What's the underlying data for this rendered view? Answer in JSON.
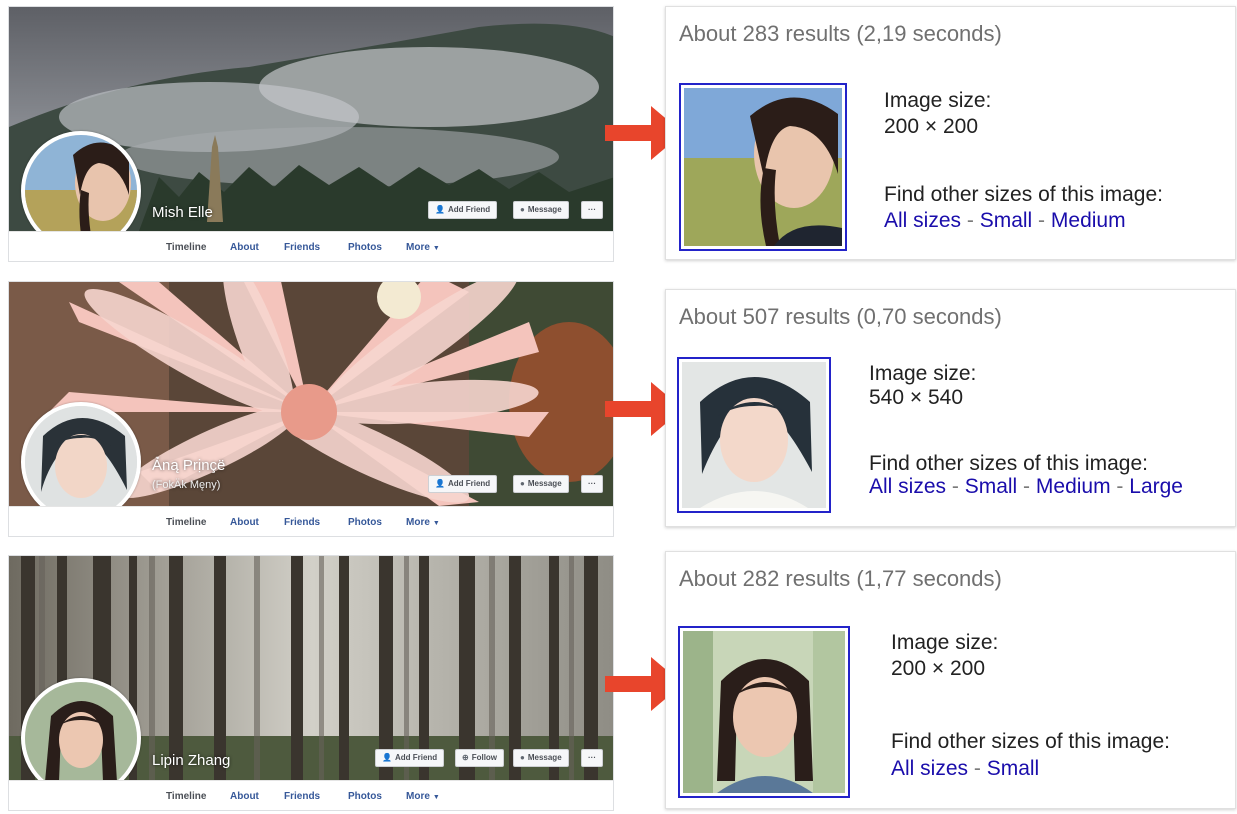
{
  "profiles": [
    {
      "name": "Mish Elle",
      "subtitle": "",
      "buttons": [
        "Add Friend",
        "Message",
        "···"
      ],
      "nav": [
        "Timeline",
        "About",
        "Friends",
        "Photos",
        "More"
      ]
    },
    {
      "name": "Ảną Prịnçë",
      "subtitle": "(FokÄk Męny)",
      "buttons": [
        "Add Friend",
        "Message",
        "···"
      ],
      "nav": [
        "Timeline",
        "About",
        "Friends",
        "Photos",
        "More"
      ]
    },
    {
      "name": "Lipin Zhang",
      "subtitle": "",
      "buttons": [
        "Add Friend",
        "Follow",
        "Message",
        "···"
      ],
      "nav": [
        "Timeline",
        "About",
        "Friends",
        "Photos",
        "More"
      ]
    }
  ],
  "results": [
    {
      "count": "About 283 results (2,19 seconds)",
      "size_label": "Image size:",
      "size_value": "200 × 200",
      "other_label": "Find other sizes of this image:",
      "links": [
        "All sizes",
        "Small",
        "Medium"
      ]
    },
    {
      "count": "About 507 results (0,70 seconds)",
      "size_label": "Image size:",
      "size_value": "540 × 540",
      "other_label": "Find other sizes of this image:",
      "links": [
        "All sizes",
        "Small",
        "Medium",
        "Large"
      ]
    },
    {
      "count": "About 282 results (1,77 seconds)",
      "size_label": "Image size:",
      "size_value": "200 × 200",
      "other_label": "Find other sizes of this image:",
      "links": [
        "All sizes",
        "Small"
      ]
    }
  ],
  "link_separator": " - ",
  "colors": {
    "arrow": "#e8452c",
    "thumb_border": "#2323c9",
    "link": "#1a0dab",
    "fb_nav_link": "#365899"
  }
}
